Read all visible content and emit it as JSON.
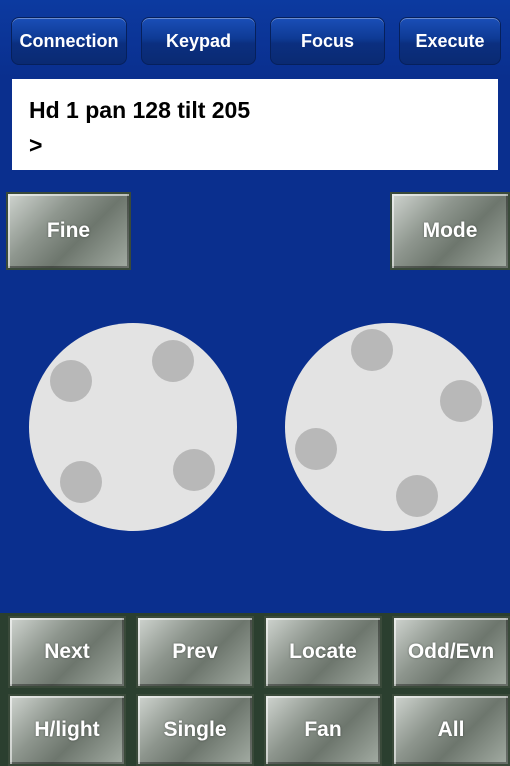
{
  "nav": {
    "connection": "Connection",
    "keypad": "Keypad",
    "focus": "Focus",
    "execute": "Execute"
  },
  "display": {
    "line1": "Hd 1 pan 128 tilt 205",
    "line2": ">"
  },
  "controls": {
    "fine": "Fine",
    "mode": "Mode"
  },
  "grid": {
    "next": "Next",
    "prev": "Prev",
    "locate": "Locate",
    "odd_evn": "Odd/Evn",
    "hlight": "H/light",
    "single": "Single",
    "fan": "Fan",
    "all": "All"
  },
  "colors": {
    "background": "#0a2f8e",
    "display": "#ffffff",
    "dial": "#e3e3e3",
    "knob": "#b8b8b8"
  }
}
